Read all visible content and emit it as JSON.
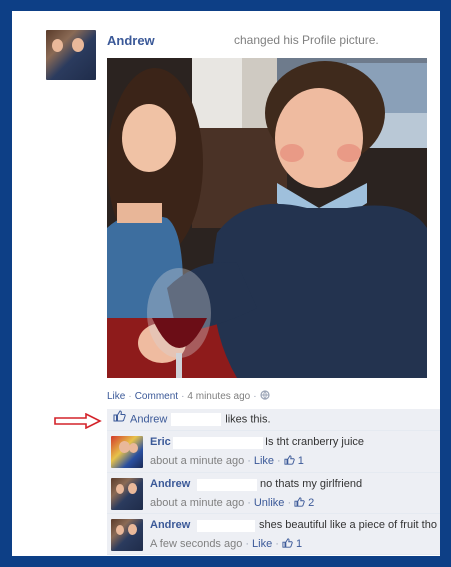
{
  "story": {
    "author": "Andrew",
    "text": "changed his Profile picture."
  },
  "actions": {
    "like": "Like",
    "comment": "Comment",
    "time": "4 minutes ago"
  },
  "likes": {
    "name": "Andrew",
    "suffix": "likes this."
  },
  "comments": [
    {
      "name": "Eric",
      "text": "Is tht cranberry juice",
      "time": "about a minute ago",
      "action": "Like",
      "like_count": "1"
    },
    {
      "name": "Andrew",
      "text": "no thats my girlfriend",
      "time": "about a minute ago",
      "action": "Unlike",
      "like_count": "2"
    },
    {
      "name": "Andrew",
      "text": "shes beautiful like a piece of fruit tho",
      "time": "A few seconds ago",
      "action": "Like",
      "like_count": "1"
    }
  ],
  "colors": {
    "frame": "#0d3f86",
    "link": "#3b5998",
    "muted": "#808080",
    "comment_bg": "#edeff4",
    "annotation_arrow": "#d4232a"
  },
  "icons": {
    "like": "thumbs-up-icon",
    "privacy": "globe-icon",
    "annotation": "red-arrow-icon"
  }
}
